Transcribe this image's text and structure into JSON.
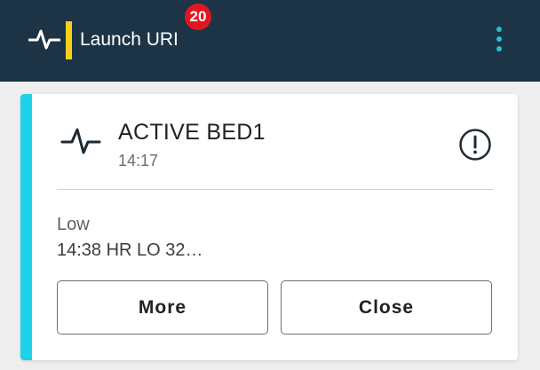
{
  "app_bar": {
    "title": "Launch URI",
    "badge_count": "20",
    "icons": {
      "app": "heartbeat-icon",
      "menu": "more-vertical-icon"
    },
    "colors": {
      "background": "#1c3446",
      "accent": "#f7d117",
      "badge": "#e3161f",
      "menu": "#24c2cf"
    }
  },
  "alert_card": {
    "title": "ACTIVE BED1",
    "time": "14:17",
    "severity": "Low",
    "message": "14:38 HR LO 32…",
    "icons": {
      "type": "heartbeat-icon",
      "status": "alert-circle-icon"
    },
    "colors": {
      "stripe": "#1ed2e9"
    },
    "actions": {
      "more_label": "More",
      "close_label": "Close"
    }
  }
}
